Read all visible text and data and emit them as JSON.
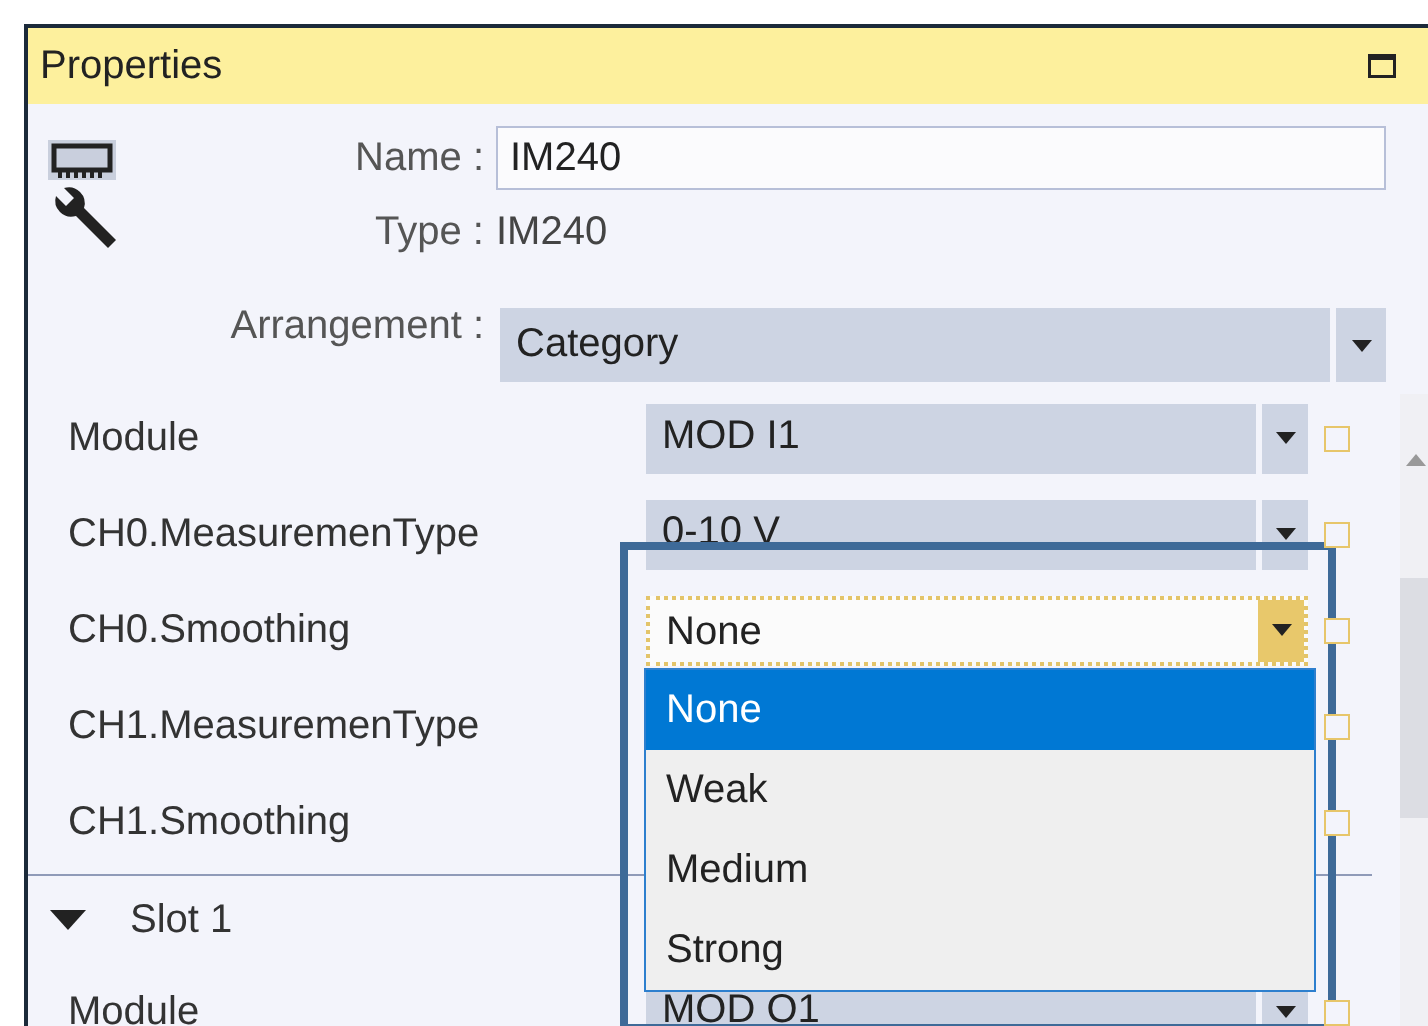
{
  "panel": {
    "title": "Properties"
  },
  "header": {
    "name_label": "Name :",
    "name_value": "IM240",
    "type_label": "Type :",
    "type_value": "IM240",
    "arrangement_label": "Arrangement :",
    "arrangement_value": "Category"
  },
  "rows": [
    {
      "kind": "combo",
      "label": "Module",
      "value": "MOD I1",
      "open": false,
      "checked": false
    },
    {
      "kind": "combo",
      "label": "CH0.MeasuremenType",
      "value": "0-10 V",
      "open": false,
      "checked": false
    },
    {
      "kind": "combo",
      "label": "CH0.Smoothing",
      "value": "None",
      "open": true,
      "checked": false,
      "options": [
        {
          "label": "None",
          "selected": true
        },
        {
          "label": "Weak",
          "selected": false
        },
        {
          "label": "Medium",
          "selected": false
        },
        {
          "label": "Strong",
          "selected": false
        }
      ]
    },
    {
      "kind": "combo",
      "label": "CH1.MeasuremenType",
      "checked": false
    },
    {
      "kind": "combo",
      "label": "CH1.Smoothing",
      "checked": false
    },
    {
      "kind": "group",
      "label": "Slot 1",
      "expanded": true
    },
    {
      "kind": "combo",
      "label": "Module",
      "value": "MOD O1",
      "open": false,
      "checked": false
    }
  ]
}
